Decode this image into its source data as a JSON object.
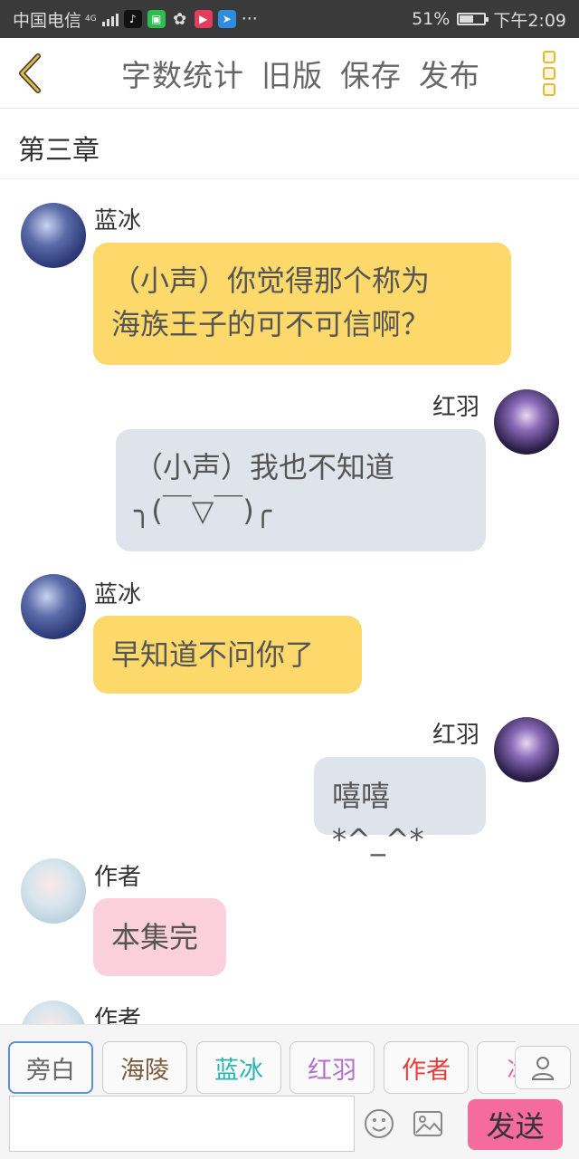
{
  "status_bar": {
    "carrier": "中国电信",
    "network": "4G",
    "battery": "51%",
    "time": "下午2:09",
    "more": "···"
  },
  "toolbar": {
    "word_count": "字数统计",
    "old_version": "旧版",
    "save": "保存",
    "publish": "发布"
  },
  "chapter": {
    "title": "第三章"
  },
  "messages": [
    {
      "speaker": "蓝冰",
      "side": "left",
      "lines": [
        "（小声）你觉得那个称为",
        "海族王子的可不可信啊？"
      ]
    },
    {
      "speaker": "红羽",
      "side": "right",
      "lines": [
        "（小声）我也不知道",
        "╮(￣▽￣)╭"
      ]
    },
    {
      "speaker": "蓝冰",
      "side": "left",
      "lines": [
        "早知道不问你了"
      ]
    },
    {
      "speaker": "红羽",
      "side": "right",
      "lines": [
        "嘻嘻*^_^*"
      ]
    },
    {
      "speaker": "作者",
      "side": "left",
      "lines": [
        "本集完"
      ]
    },
    {
      "speaker": "作者",
      "side": "left",
      "lines": []
    }
  ],
  "roles": [
    {
      "label": "旁白",
      "color": "#666666",
      "selected": true
    },
    {
      "label": "海陵",
      "color": "#7a5a3a",
      "selected": false
    },
    {
      "label": "蓝冰",
      "color": "#2bb5b5",
      "selected": false
    },
    {
      "label": "红羽",
      "color": "#b36fd0",
      "selected": false
    },
    {
      "label": "作者",
      "color": "#e0413a",
      "selected": false
    },
    {
      "label": "冰",
      "color": "#e06aa8",
      "selected": false
    }
  ],
  "input": {
    "placeholder": "",
    "value": ""
  },
  "send_label": "发送",
  "colors": {
    "accent_yellow": "#fcd96a",
    "bubble_grey": "#dfe4ec",
    "bubble_pink": "#fbd0dc",
    "send_pink": "#f56b9c",
    "back_arrow": "#e2b93b"
  }
}
